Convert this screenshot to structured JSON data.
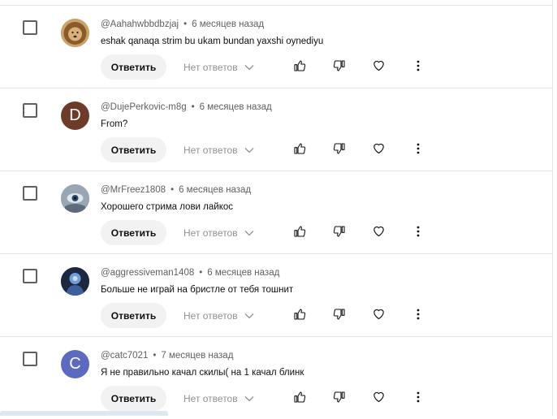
{
  "comments": [
    {
      "username": "@Aahahwbbdbzjaj",
      "time": "6 месяцев назад",
      "text": "eshak qanaqa strim bu ukam bundan yaxshi oynediyu",
      "avatar": {
        "type": "image",
        "icon": "lion-avatar",
        "color": "#b08448"
      },
      "reply_label": "Ответить",
      "replies_label": "Нет ответов"
    },
    {
      "username": "@DujePerkovic-m8g",
      "time": "6 месяцев назад",
      "text": "From?",
      "avatar": {
        "type": "letter",
        "letter": "D",
        "color": "#6d3b2a"
      },
      "reply_label": "Ответить",
      "replies_label": "Нет ответов"
    },
    {
      "username": "@MrFreez1808",
      "time": "6 месяцев назад",
      "text": "Хорошего стрима лови лайкос",
      "avatar": {
        "type": "image",
        "icon": "eye-avatar",
        "color": "#8b98a8"
      },
      "reply_label": "Ответить",
      "replies_label": "Нет ответов"
    },
    {
      "username": "@aggressiveman1408",
      "time": "6 месяцев назад",
      "text": "Больше не играй на бристле от тебя тошнит",
      "avatar": {
        "type": "image",
        "icon": "character-avatar",
        "color": "#2a3a55"
      },
      "reply_label": "Ответить",
      "replies_label": "Нет ответов"
    },
    {
      "username": "@catc7021",
      "time": "7 месяцев назад",
      "text": "Я не правильно качал скилы( на 1 качал блинк",
      "avatar": {
        "type": "letter",
        "letter": "C",
        "color": "#5c6bc0"
      },
      "reply_label": "Ответить",
      "replies_label": "Нет ответов"
    }
  ],
  "icons": {
    "like": "thumb-up-icon",
    "dislike": "thumb-down-icon",
    "heart": "heart-icon",
    "more": "more-vert-icon",
    "chevron": "chevron-down-icon"
  }
}
